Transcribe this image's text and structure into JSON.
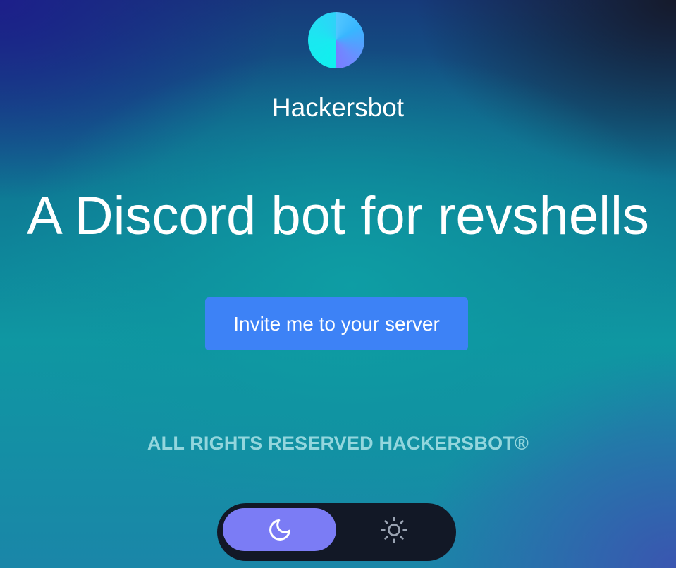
{
  "brand": {
    "name": "Hackersbot",
    "logo_colors": [
      "#10f0ee",
      "#7a7cff"
    ]
  },
  "hero": {
    "headline": "A Discord bot for revshells",
    "cta_label": "Invite me to your server"
  },
  "footer": {
    "rights": "ALL RIGHTS RESERVED HACKERSBOT®"
  },
  "theme_toggle": {
    "options": [
      {
        "name": "dark",
        "icon": "moon-icon",
        "selected": true
      },
      {
        "name": "light",
        "icon": "sun-icon",
        "selected": false
      }
    ],
    "active_color": "#7b7cf5",
    "track_color": "#121826"
  },
  "colors": {
    "button": "#3d82f6",
    "rights_text": "#93d6dd"
  }
}
